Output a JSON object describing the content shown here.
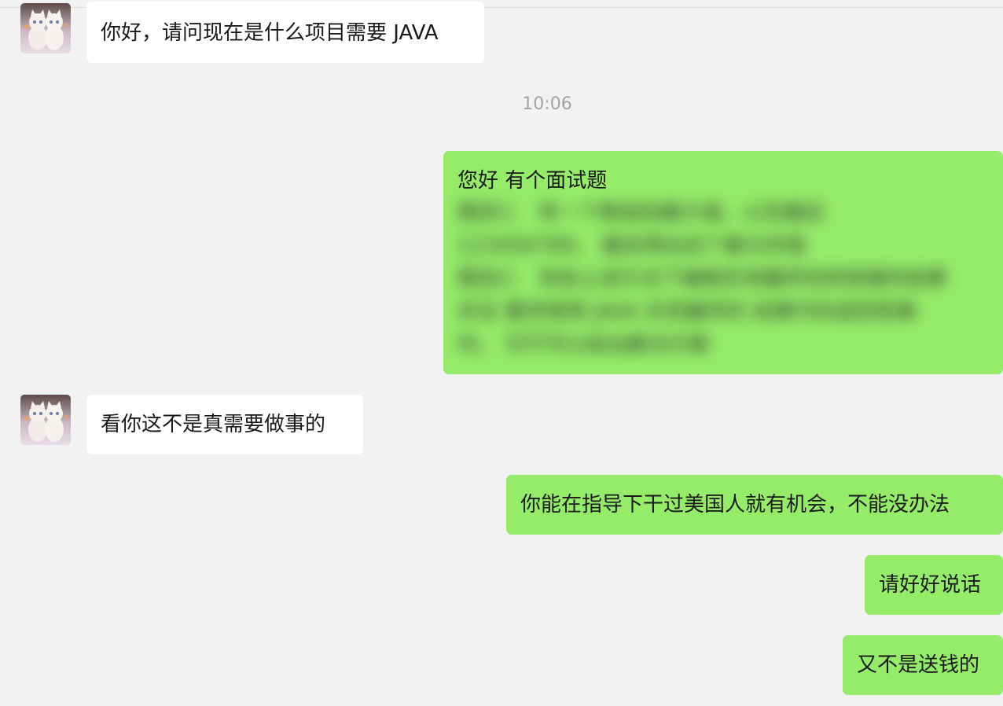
{
  "messages": [
    {
      "from": "contact",
      "text": "你好，请问现在是什么项目需要 JAVA"
    },
    {
      "timestamp": "10:06"
    },
    {
      "from": "me",
      "text": "您好 有个面试题",
      "redacted_lines": [
        "题目1： 有一个数组找最大值，以及最后",
        "123456789， 最后得出这个最大的值",
        "题目2： 有如上述方法下编程实现最终找到答案的结果",
        "并且 要求使用 JAVA 实现最终的 结果代码返回答案",
        "吗， 可不可以给出解决方案"
      ]
    },
    {
      "from": "contact",
      "text": "看你这不是真需要做事的"
    },
    {
      "from": "me",
      "text": "你能在指导下干过美国人就有机会，不能没办法"
    },
    {
      "from": "me",
      "text": "请好好说话"
    },
    {
      "from": "me",
      "text": "又不是送钱的"
    }
  ],
  "colors": {
    "background": "#f2f2f2",
    "incoming_bubble": "#ffffff",
    "outgoing_bubble": "#95ec69",
    "timestamp_text": "#a3a3a3"
  },
  "icons": {
    "contact_avatar": "two-white-kittens-avatar"
  }
}
